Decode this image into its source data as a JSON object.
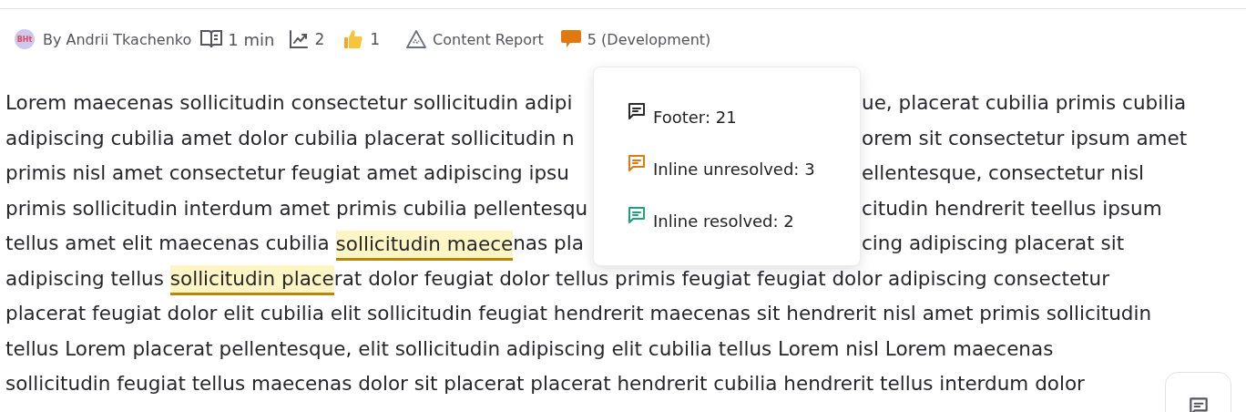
{
  "meta": {
    "avatar_text": "BHt",
    "author": "By Andrii Tkachenko",
    "read_time": "1 min",
    "views": "2",
    "likes": "1",
    "report": "Content Report",
    "comments": "5 (Development)"
  },
  "popover": {
    "items": [
      {
        "label": "Footer: 21",
        "color": "#2b2b2b"
      },
      {
        "label": "Inline unresolved: 3",
        "color": "#e07a10"
      },
      {
        "label": "Inline resolved: 2",
        "color": "#1fa37a"
      }
    ]
  },
  "lines": [
    {
      "segments": [
        {
          "kind": "plain",
          "text": "Lorem maecenas sollicitudin consectetur sollicitudin adipi"
        }
      ],
      "right": "ue, placerat cubilia primis cubilia"
    },
    {
      "segments": [
        {
          "kind": "plain",
          "text": "adipiscing cubilia amet dolor cubilia placerat sollicitudin n"
        }
      ],
      "right": "orem sit consectetur ipsum amet"
    },
    {
      "segments": [
        {
          "kind": "plain",
          "text": "primis nisl amet consectetur feugiat amet adipiscing ipsu"
        }
      ],
      "right": "ellentesque, consectetur nisl"
    },
    {
      "segments": [
        {
          "kind": "plain",
          "text": "primis sollicitudin interdum amet primis cubilia pellentesqu"
        }
      ],
      "right": "citudin hendrerit teellus ipsum"
    },
    {
      "segments": [
        {
          "kind": "plain",
          "text": "tellus amet elit maecenas cubilia "
        },
        {
          "kind": "highlight",
          "text": "sollicitudin maece"
        },
        {
          "kind": "plain",
          "text": "nas pla"
        }
      ],
      "right": "cing adipiscing placerat sit"
    },
    {
      "segments": [
        {
          "kind": "plain",
          "text": "adipiscing tellus "
        },
        {
          "kind": "highlight",
          "text": "sollicitudin place"
        },
        {
          "kind": "plain",
          "text": "rat dolor feugiat dolor tellus primis feugiat feugiat dolor adipiscing consectetur"
        }
      ]
    },
    {
      "segments": [
        {
          "kind": "plain",
          "text": "placerat feugiat dolor elit cubilia elit sollicitudin feugiat hendrerit maecenas sit hendrerit nisl amet primis sollicitudin"
        }
      ]
    },
    {
      "segments": [
        {
          "kind": "plain",
          "text": "tellus Lorem placerat pellentesque, elit sollicitudin adipiscing elit cubilia tellus Lorem nisl Lorem maecenas"
        }
      ]
    },
    {
      "segments": [
        {
          "kind": "plain",
          "text": "sollicitudin feugiat tellus maecenas dolor sit placerat placerat hendrerit cubilia hendrerit tellus interdum dolor"
        }
      ]
    }
  ]
}
